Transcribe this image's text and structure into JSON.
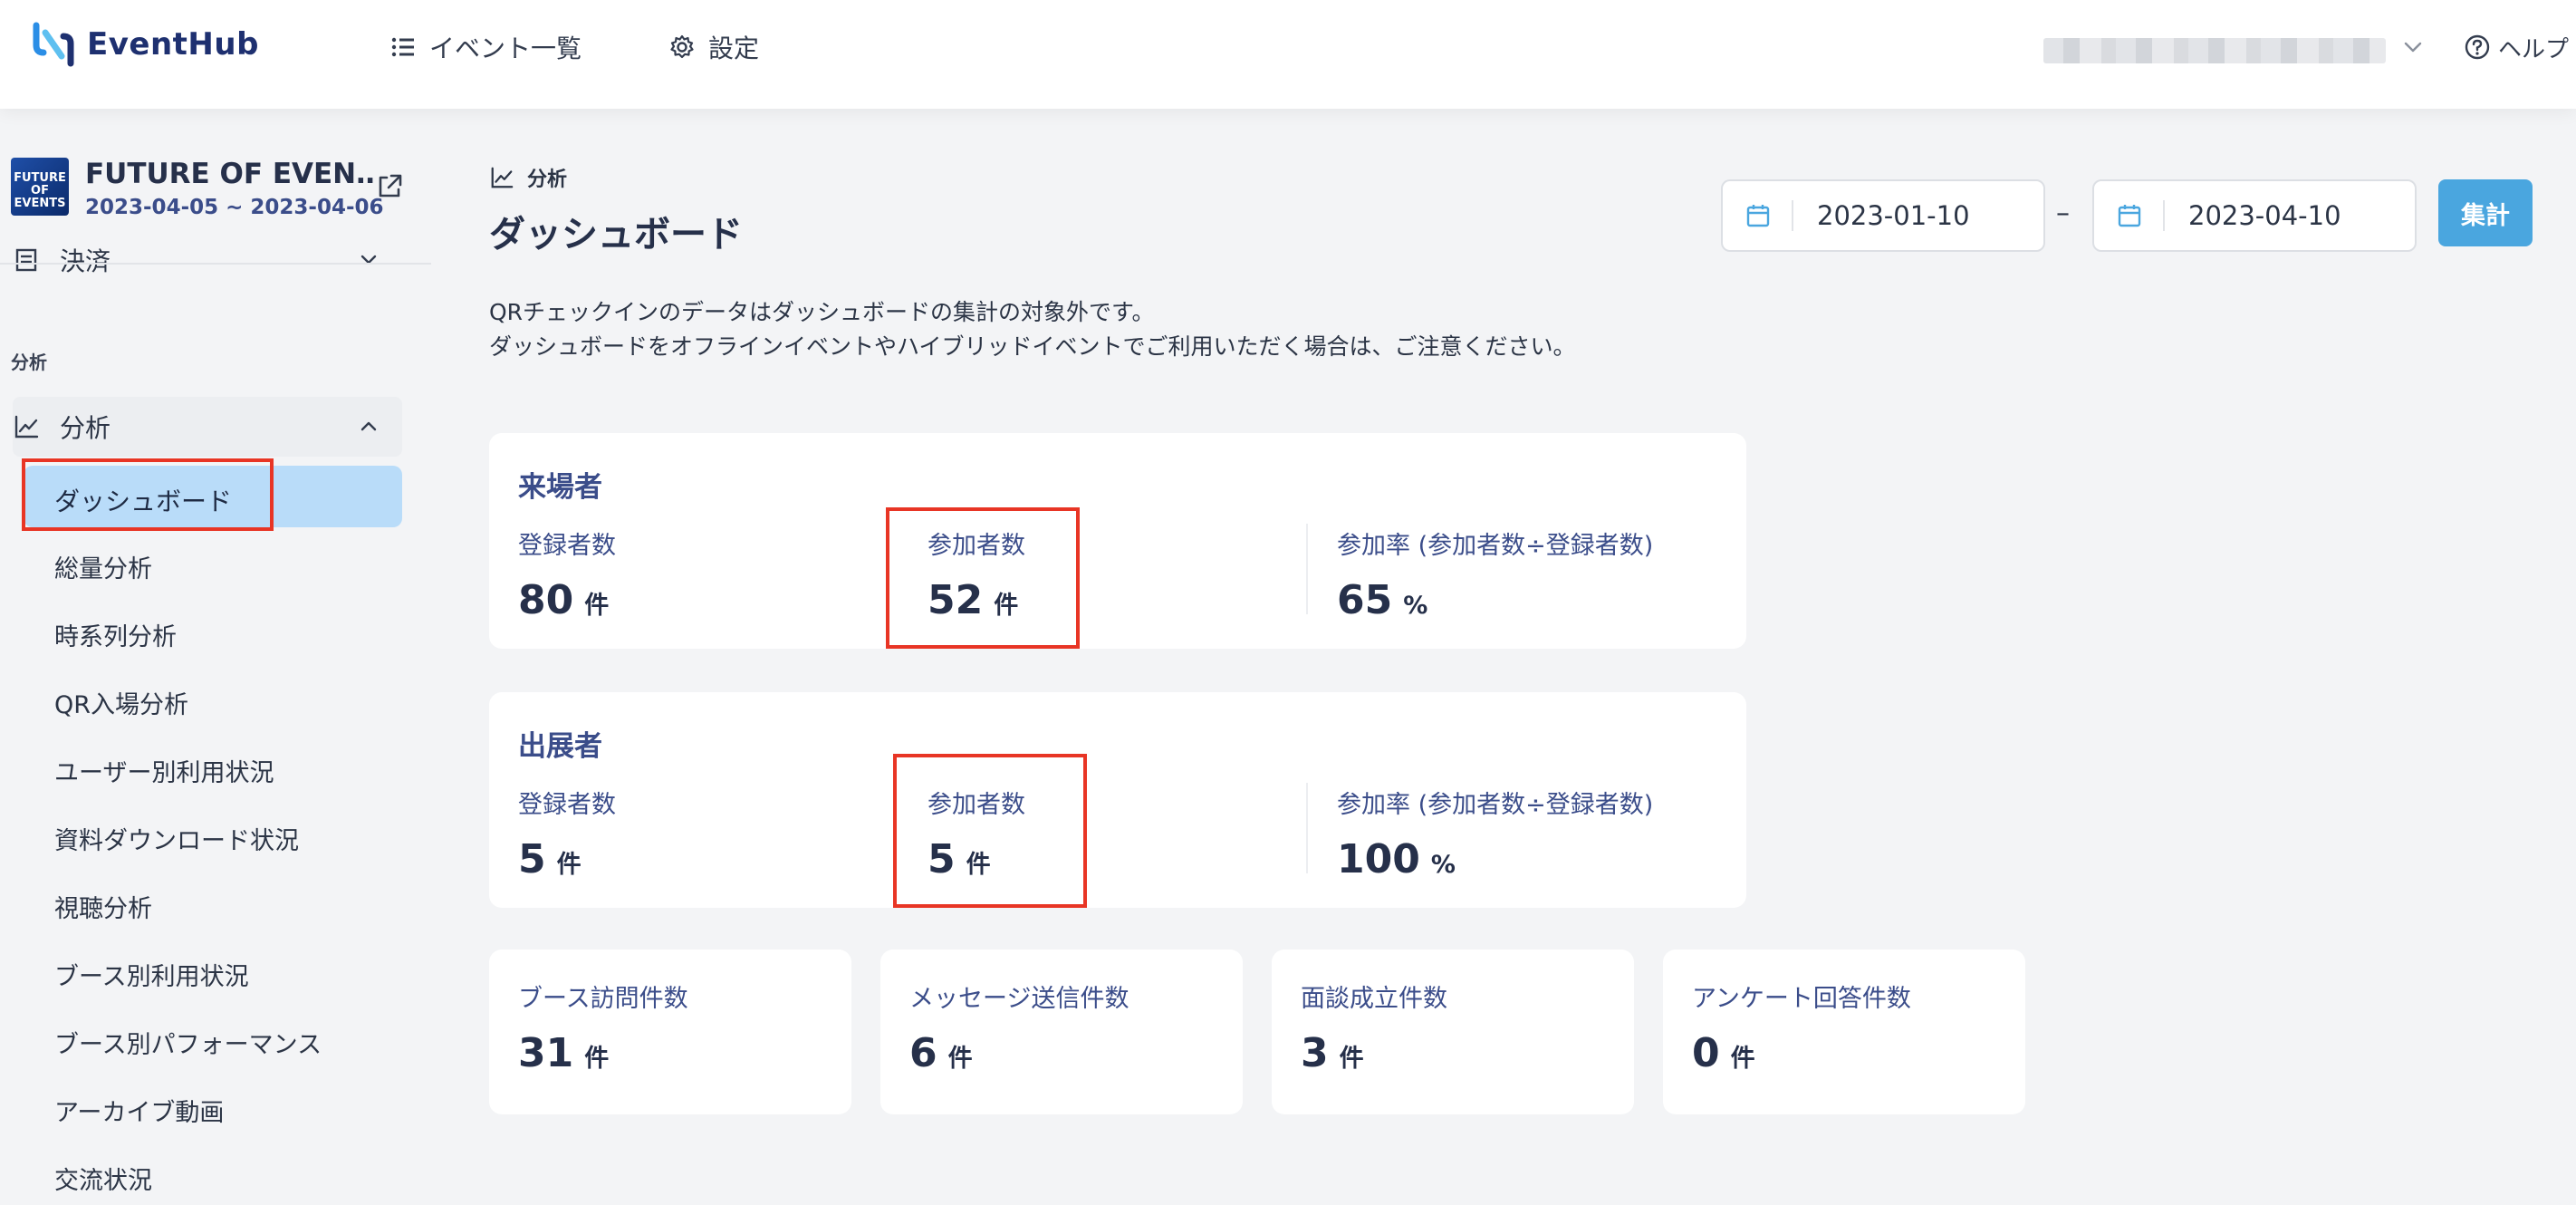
{
  "header": {
    "logo_text": "EventHub",
    "nav": {
      "events_label": "イベント一覧",
      "settings_label": "設定"
    },
    "help_label": "ヘルプ"
  },
  "sidebar": {
    "event": {
      "thumb_text": "FUTURE OF EVENTS",
      "title": "FUTURE OF EVEN…",
      "dates": "2023-04-05 ~ 2023-04-06"
    },
    "partial_item": "決済",
    "section_label": "分析",
    "group_label": "分析",
    "items": [
      "ダッシュボード",
      "総量分析",
      "時系列分析",
      "QR入場分析",
      "ユーザー別利用状況",
      "資料ダウンロード状況",
      "視聴分析",
      "ブース別利用状況",
      "ブース別パフォーマンス",
      "アーカイブ動画",
      "交流状況"
    ]
  },
  "main": {
    "breadcrumb": "分析",
    "title": "ダッシュボード",
    "date_from": "2023-01-10",
    "date_dash": "–",
    "date_to": "2023-04-10",
    "aggregate_button": "集計",
    "notice_line1": "QRチェックインのデータはダッシュボードの集計の対象外です。",
    "notice_line2": "ダッシュボードをオフラインイベントやハイブリッドイベントでご利用いただく場合は、ご注意ください。",
    "visitors": {
      "title": "来場者",
      "registered_label": "登録者数",
      "registered_value": "80",
      "registered_unit": "件",
      "participants_label": "参加者数",
      "participants_value": "52",
      "participants_unit": "件",
      "rate_label": "参加率 (参加者数÷登録者数)",
      "rate_value": "65",
      "rate_unit": "%"
    },
    "exhibitors": {
      "title": "出展者",
      "registered_label": "登録者数",
      "registered_value": "5",
      "registered_unit": "件",
      "participants_label": "参加者数",
      "participants_value": "5",
      "participants_unit": "件",
      "rate_label": "参加率 (参加者数÷登録者数)",
      "rate_value": "100",
      "rate_unit": "%"
    },
    "stats": [
      {
        "label": "ブース訪問件数",
        "value": "31",
        "unit": "件"
      },
      {
        "label": "メッセージ送信件数",
        "value": "6",
        "unit": "件"
      },
      {
        "label": "面談成立件数",
        "value": "3",
        "unit": "件"
      },
      {
        "label": "アンケート回答件数",
        "value": "0",
        "unit": "件"
      }
    ]
  },
  "colors": {
    "brand": "#1e3070",
    "accent_blue": "#4aa6df",
    "active_item_bg": "#b9dcf9",
    "highlight_box": "#e83525"
  }
}
